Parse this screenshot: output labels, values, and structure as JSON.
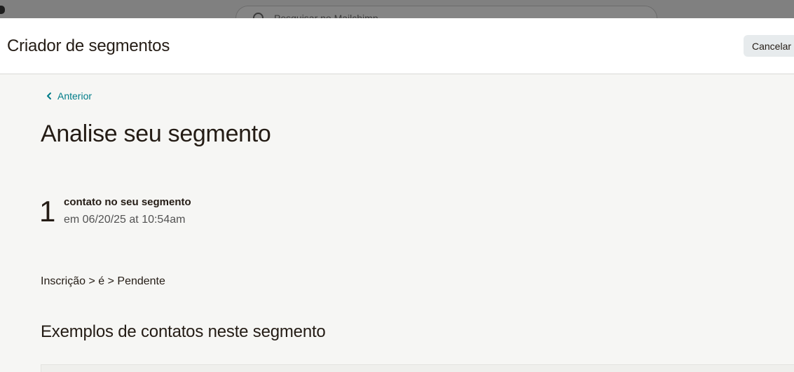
{
  "backdrop": {
    "search_text": "Pesquisar no Mailchimp"
  },
  "header": {
    "title": "Criador de segmentos",
    "cancel_label": "Cancelar"
  },
  "nav": {
    "back_label": "Anterior"
  },
  "main": {
    "title": "Analise seu segmento",
    "count": "1",
    "count_label": "contato no seu segmento",
    "count_date": "em 06/20/25 at 10:54am",
    "condition": "Inscrição > é > Pendente",
    "examples_title": "Exemplos de contatos neste segmento"
  },
  "colors": {
    "accent": "#007c89",
    "text": "#241c15",
    "background": "#f6f6f4",
    "cancel_bg": "#e7ebed"
  },
  "icons": {
    "back": "chevron-left-icon",
    "search": "search-icon"
  }
}
